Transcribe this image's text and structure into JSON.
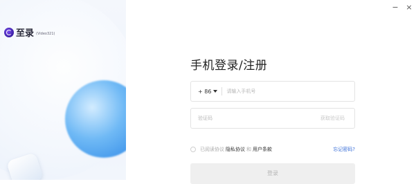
{
  "window": {
    "minimize_label": "−",
    "close_label": "×"
  },
  "brand": {
    "name": "至录",
    "sub": "(Video321)"
  },
  "form": {
    "title": "手机登录/注册",
    "phone": {
      "country_code": "+ 86",
      "placeholder": "请输入手机号",
      "value": ""
    },
    "code": {
      "placeholder": "验证码",
      "value": "",
      "get_code_label": "获取验证码"
    },
    "agreement": {
      "prefix": "已阅读协议",
      "privacy_label": "隐私协议",
      "and": "和",
      "terms_label": "用户条款",
      "forgot_label": "忘记密码?"
    },
    "login_label": "登录"
  },
  "colors": {
    "accent_blue": "#2c86e6",
    "link": "#3a6fd8",
    "button_disabled": "#efefef"
  }
}
